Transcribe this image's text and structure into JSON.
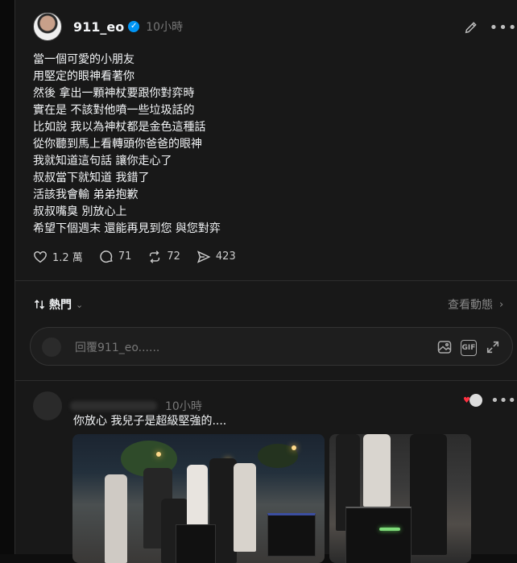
{
  "post": {
    "username": "911_eo",
    "time": "10小時",
    "lines": [
      "當一個可愛的小朋友",
      "用堅定的眼神看著你",
      "然後 拿出一顆神杖要跟你對弈時",
      "實在是 不該對他噴一些垃圾話的",
      "比如說 我以為神杖都是金色這種話",
      "從你聽到馬上看轉頭你爸爸的眼神",
      "我就知道這句話 讓你走心了",
      "叔叔當下就知道 我錯了",
      "活該我會輸 弟弟抱歉",
      "叔叔嘴臭 別放心上",
      "希望下個週末 還能再見到您 與您對弈"
    ],
    "likes": "1.2 萬",
    "comments": "71",
    "reposts": "72",
    "shares": "423"
  },
  "sort": {
    "label": "熱門"
  },
  "activity": {
    "label": "查看動態"
  },
  "reply": {
    "placeholder": "回覆911_eo......"
  },
  "comment": {
    "time": "10小時",
    "text": "你放心 我兒子是超級堅強的...."
  },
  "colors": {
    "verified": "#0095f6",
    "like_heart": "#ff3040",
    "background": "#181818"
  }
}
